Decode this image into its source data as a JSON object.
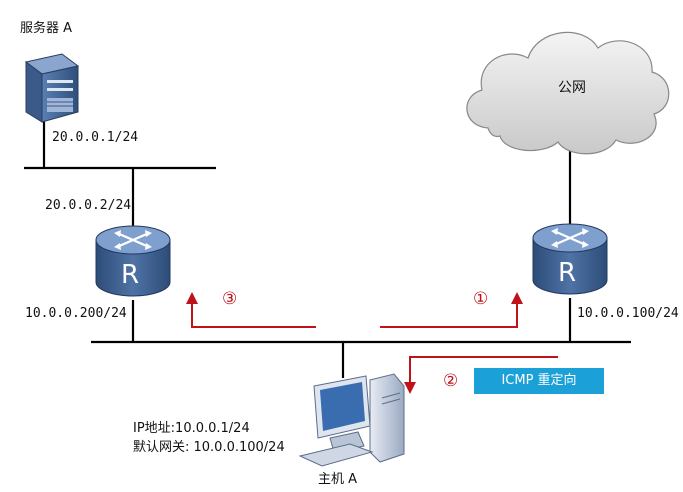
{
  "server": {
    "name": "服务器 A",
    "ip": "20.0.0.1/24"
  },
  "router_left": {
    "ip_top": "20.0.0.2/24",
    "ip_bottom": "10.0.0.200/24",
    "letter": "R"
  },
  "router_right": {
    "ip_bottom": "10.0.0.100/24",
    "letter": "R"
  },
  "internet": {
    "label": "公网"
  },
  "host": {
    "name": "主机 A",
    "ip_line": "IP地址:10.0.0.1/24",
    "gateway_line": "默认网关: 10.0.0.100/24"
  },
  "steps": {
    "one": "①",
    "two": "②",
    "three": "③"
  },
  "redirect_badge": "ICMP 重定向",
  "colors": {
    "arrow": "#c0121a",
    "badge": "#1ba1d8",
    "device_dark": "#2f4f7a",
    "device_light": "#6f8fbf"
  }
}
